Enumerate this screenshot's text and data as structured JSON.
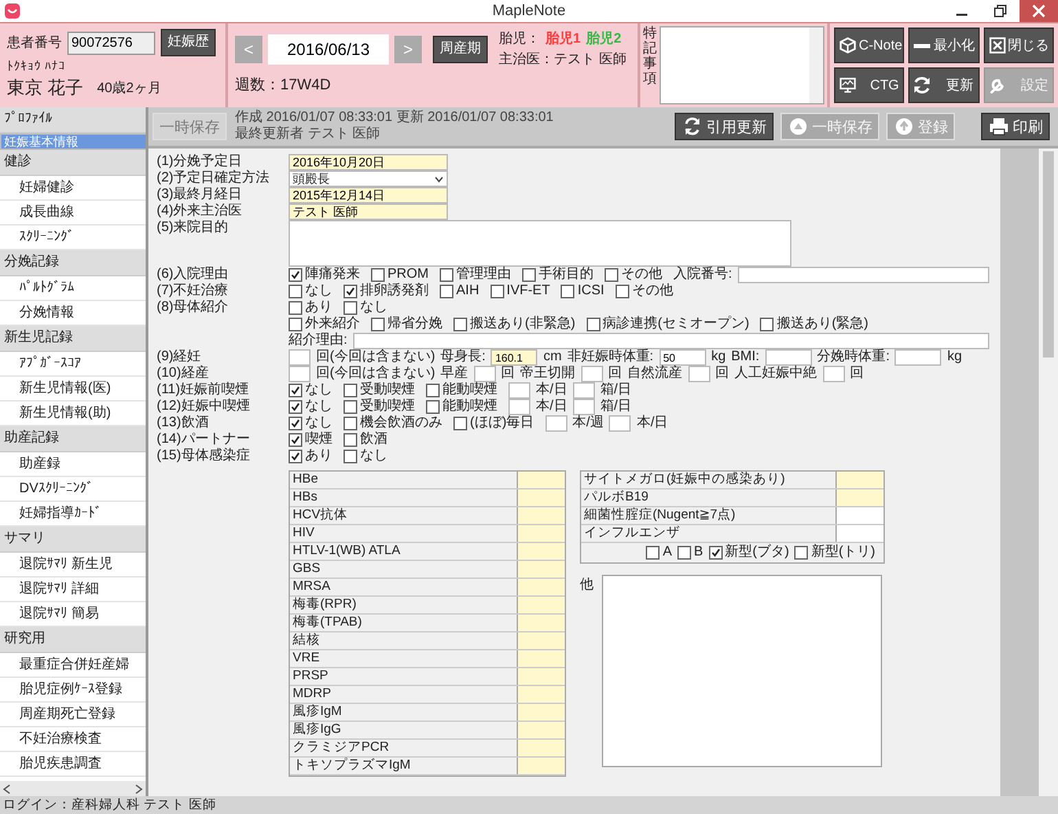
{
  "window": {
    "title": "MapleNote"
  },
  "patient": {
    "id_label": "患者番号",
    "id": "90072576",
    "history_button": "妊娠歴",
    "kana": "ﾄｸｷｮｳ ﾊﾅｺ",
    "name": "東京 花子",
    "age": "40歳2ヶ月"
  },
  "visit": {
    "prev": "<",
    "date": "2016/06/13",
    "next": ">",
    "period_button": "周産期",
    "weeks": "週数：17W4D",
    "fetus_label": "胎児：",
    "fetuses": [
      {
        "label": "胎児1",
        "color": "#ff3b3b"
      },
      {
        "label": "胎児2",
        "color": "#33bb44"
      }
    ],
    "doctor": "主治医：テスト 医師"
  },
  "notes": {
    "label": "特記事項"
  },
  "header_buttons": [
    {
      "label": "C-Note",
      "disabled": false
    },
    {
      "label": "最小化",
      "disabled": false
    },
    {
      "label": "閉じる",
      "disabled": false
    },
    {
      "label": "CTG",
      "disabled": false
    },
    {
      "label": "更新",
      "disabled": false
    },
    {
      "label": "設定",
      "disabled": true
    }
  ],
  "sidebar": {
    "groups": [
      {
        "label": "ﾌﾟﾛﾌｧｲﾙ",
        "items": [
          {
            "label": "妊娠基本情報",
            "selected": true
          }
        ]
      },
      {
        "label": "健診",
        "items": [
          {
            "label": "妊婦健診",
            "selected": false
          },
          {
            "label": "成長曲線",
            "selected": false
          },
          {
            "label": "ｽｸﾘｰﾆﾝｸﾞ",
            "selected": false
          }
        ]
      },
      {
        "label": "分娩記録",
        "items": [
          {
            "label": "ﾊﾟﾙﾄｸﾞﾗﾑ",
            "selected": false
          },
          {
            "label": "分娩情報",
            "selected": false
          }
        ]
      },
      {
        "label": "新生児記録",
        "items": [
          {
            "label": "ｱﾌﾟｶﾞｰｽｺｱ",
            "selected": false
          },
          {
            "label": "新生児情報(医)",
            "selected": false
          },
          {
            "label": "新生児情報(助)",
            "selected": false
          }
        ]
      },
      {
        "label": "助産記録",
        "items": [
          {
            "label": "助産録",
            "selected": false
          },
          {
            "label": "DVｽｸﾘｰﾆﾝｸﾞ",
            "selected": false
          },
          {
            "label": "妊婦指導ｶｰﾄﾞ",
            "selected": false
          }
        ]
      },
      {
        "label": "サマリ",
        "items": [
          {
            "label": "退院ｻﾏﾘ 新生児",
            "selected": false
          },
          {
            "label": "退院ｻﾏﾘ 詳細",
            "selected": false
          },
          {
            "label": "退院ｻﾏﾘ 簡易",
            "selected": false
          }
        ]
      },
      {
        "label": "研究用",
        "items": [
          {
            "label": "最重症合併妊産婦",
            "selected": false
          },
          {
            "label": "胎児症例ｹｰｽ登録",
            "selected": false
          },
          {
            "label": "周産期死亡登録",
            "selected": false
          },
          {
            "label": "不妊治療検査",
            "selected": false
          },
          {
            "label": "胎児疾患調査",
            "selected": false
          }
        ]
      }
    ]
  },
  "toolbar": {
    "draft_button": {
      "label": "一時保存",
      "disabled": true
    },
    "info": [
      "作成 2016/01/07 08:33:01 更新 2016/01/07 08:33:01",
      "最終更新者 テスト 医師"
    ],
    "buttons": [
      {
        "label": "引用更新",
        "disabled": false
      },
      {
        "label": "一時保存",
        "disabled": true
      },
      {
        "label": "登録",
        "disabled": true
      },
      {
        "label": "印刷",
        "disabled": false
      }
    ]
  },
  "form": {
    "rows": [
      {
        "kind": "input",
        "label": "(1)分娩予定日",
        "value": "2016年10月20日"
      },
      {
        "kind": "select",
        "label": "(2)予定日確定方法",
        "value": "頭殿長"
      },
      {
        "kind": "input",
        "label": "(3)最終月経日",
        "value": "2015年12月14日"
      },
      {
        "kind": "input",
        "label": "(4)外来主治医",
        "value": "テスト 医師"
      },
      {
        "kind": "textarea",
        "label": "(5)来院目的"
      },
      {
        "kind": "parts",
        "label": "(6)入院理由",
        "parts": [
          {
            "kind": "check",
            "label": "陣痛発来",
            "checked": true
          },
          {
            "kind": "check",
            "label": "PROM",
            "checked": false
          },
          {
            "kind": "check",
            "label": "管理理由",
            "checked": false
          },
          {
            "kind": "check",
            "label": "手術目的",
            "checked": false
          },
          {
            "kind": "check",
            "label": "その他",
            "checked": false
          },
          {
            "kind": "text",
            "text": "入院番号:"
          },
          {
            "kind": "wide_field"
          }
        ]
      },
      {
        "kind": "parts",
        "label": "(7)不妊治療",
        "parts": [
          {
            "kind": "check",
            "label": "なし",
            "checked": false
          },
          {
            "kind": "check",
            "label": "排卵誘発剤",
            "checked": true
          },
          {
            "kind": "check",
            "label": "AIH",
            "checked": false
          },
          {
            "kind": "check",
            "label": "IVF-ET",
            "checked": false
          },
          {
            "kind": "check",
            "label": "ICSI",
            "checked": false
          },
          {
            "kind": "check",
            "label": "その他",
            "checked": false
          }
        ]
      },
      {
        "kind": "parts",
        "label": "(8)母体紹介",
        "parts": [
          {
            "kind": "check",
            "label": "あり",
            "checked": false
          },
          {
            "kind": "check",
            "label": "なし",
            "checked": false
          }
        ]
      },
      {
        "kind": "parts",
        "parts": [
          {
            "kind": "check",
            "label": "外来紹介",
            "checked": false
          },
          {
            "kind": "check",
            "label": "帰省分娩",
            "checked": false
          },
          {
            "kind": "check",
            "label": "搬送あり(非緊急)",
            "checked": false
          },
          {
            "kind": "check",
            "label": "病診連携(セミオープン)",
            "checked": false
          },
          {
            "kind": "check",
            "label": "搬送あり(緊急)",
            "checked": false
          }
        ]
      },
      {
        "kind": "parts",
        "parts": [
          {
            "kind": "text",
            "text": "紹介理由:"
          },
          {
            "kind": "wide_field"
          }
        ]
      },
      {
        "kind": "parts",
        "label": "(9)経妊",
        "parts": [
          {
            "kind": "box"
          },
          {
            "kind": "text",
            "text": "回(今回は含まない)"
          },
          {
            "kind": "text",
            "text": "母身長:"
          },
          {
            "kind": "field",
            "value": "160.1",
            "required": true
          },
          {
            "kind": "text",
            "text": "cm"
          },
          {
            "kind": "text",
            "text": "非妊娠時体重:"
          },
          {
            "kind": "field",
            "value": "50",
            "required": false
          },
          {
            "kind": "text",
            "text": "kg"
          },
          {
            "kind": "text",
            "text": "BMI:"
          },
          {
            "kind": "field",
            "required": false
          },
          {
            "kind": "text",
            "text": "分娩時体重:"
          },
          {
            "kind": "field",
            "required": false
          },
          {
            "kind": "text",
            "text": "kg"
          }
        ]
      },
      {
        "kind": "parts",
        "label": "(10)経産",
        "parts": [
          {
            "kind": "box"
          },
          {
            "kind": "text",
            "text": "回(今回は含まない)"
          },
          {
            "kind": "text",
            "text": "早産"
          },
          {
            "kind": "box"
          },
          {
            "kind": "text",
            "text": "回"
          },
          {
            "kind": "text",
            "text": "帝王切開"
          },
          {
            "kind": "box"
          },
          {
            "kind": "text",
            "text": "回"
          },
          {
            "kind": "text",
            "text": "自然流産"
          },
          {
            "kind": "box"
          },
          {
            "kind": "text",
            "text": "回"
          },
          {
            "kind": "text",
            "text": "人工妊娠中絶"
          },
          {
            "kind": "box"
          },
          {
            "kind": "text",
            "text": "回"
          }
        ]
      },
      {
        "kind": "parts",
        "label": "(11)妊娠前喫煙",
        "parts": [
          {
            "kind": "check",
            "label": "なし",
            "checked": true
          },
          {
            "kind": "check",
            "label": "受動喫煙",
            "checked": false
          },
          {
            "kind": "check",
            "label": "能動喫煙",
            "checked": false
          },
          {
            "kind": "box"
          },
          {
            "kind": "text",
            "text": "本/日"
          },
          {
            "kind": "box"
          },
          {
            "kind": "text",
            "text": "箱/日"
          }
        ]
      },
      {
        "kind": "parts",
        "label": "(12)妊娠中喫煙",
        "parts": [
          {
            "kind": "check",
            "label": "なし",
            "checked": true
          },
          {
            "kind": "check",
            "label": "受動喫煙",
            "checked": false
          },
          {
            "kind": "check",
            "label": "能動喫煙",
            "checked": false
          },
          {
            "kind": "box"
          },
          {
            "kind": "text",
            "text": "本/日"
          },
          {
            "kind": "box"
          },
          {
            "kind": "text",
            "text": "箱/日"
          }
        ]
      },
      {
        "kind": "parts",
        "label": "(13)飲酒",
        "parts": [
          {
            "kind": "check",
            "label": "なし",
            "checked": true
          },
          {
            "kind": "check",
            "label": "機会飲酒のみ",
            "checked": false
          },
          {
            "kind": "check",
            "label": "(ほぼ)毎日",
            "checked": false
          },
          {
            "kind": "box"
          },
          {
            "kind": "text",
            "text": "本/週"
          },
          {
            "kind": "box"
          },
          {
            "kind": "text",
            "text": "本/日"
          }
        ]
      },
      {
        "kind": "parts",
        "label": "(14)パートナー",
        "parts": [
          {
            "kind": "check",
            "label": "喫煙",
            "checked": true
          },
          {
            "kind": "check",
            "label": "飲酒",
            "checked": false
          }
        ]
      },
      {
        "kind": "parts",
        "label": "(15)母体感染症",
        "parts": [
          {
            "kind": "check",
            "label": "あり",
            "checked": true
          },
          {
            "kind": "check",
            "label": "なし",
            "checked": false
          }
        ]
      }
    ]
  },
  "infections": {
    "left": [
      {
        "label": "HBe",
        "required": true
      },
      {
        "label": "HBs",
        "required": true
      },
      {
        "label": "HCV抗体",
        "required": true
      },
      {
        "label": "HIV",
        "required": true
      },
      {
        "label": "HTLV-1(WB) ATLA",
        "required": true
      },
      {
        "label": "GBS",
        "required": true
      },
      {
        "label": "MRSA",
        "required": true
      },
      {
        "label": "梅毒(RPR)",
        "required": true
      },
      {
        "label": "梅毒(TPAB)",
        "required": true
      },
      {
        "label": "結核",
        "required": true
      },
      {
        "label": "VRE",
        "required": true
      },
      {
        "label": "PRSP",
        "required": true
      },
      {
        "label": "MDRP",
        "required": true
      },
      {
        "label": "風疹IgM",
        "required": true
      },
      {
        "label": "風疹IgG",
        "required": true
      },
      {
        "label": "クラミジアPCR",
        "required": true
      },
      {
        "label": "トキソプラズマIgM",
        "required": true
      }
    ],
    "right": [
      {
        "label": "サイトメガロ(妊娠中の感染あり)",
        "required": true
      },
      {
        "label": "パルボB19",
        "required": true
      },
      {
        "label": "細菌性腟症(Nugent≧7点)",
        "required": false
      },
      {
        "label": "インフルエンザ",
        "required": false
      }
    ],
    "flu_options": [
      {
        "label": "A",
        "checked": false
      },
      {
        "label": "B",
        "checked": false
      },
      {
        "label": "新型(ブタ)",
        "checked": true
      },
      {
        "label": "新型(トリ)",
        "checked": false
      }
    ],
    "other_label": "他"
  },
  "status_bar": "ログイン：産科婦人科 テスト 医師"
}
